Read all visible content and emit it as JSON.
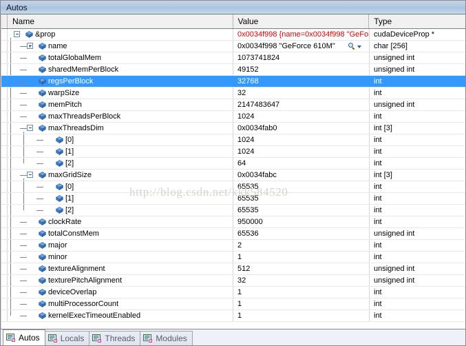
{
  "window": {
    "title": "Autos"
  },
  "columns": {
    "name": "Name",
    "value": "Value",
    "type": "Type"
  },
  "icons": {
    "field": "field-icon",
    "magnifier": "magnifier-visualizer-icon",
    "dropdown": "chevron-down-icon",
    "expand": "plus-expander-icon",
    "collapse": "minus-expander-icon"
  },
  "colors": {
    "selection": "#3399ff",
    "modified_value": "#d90000",
    "title_bar": "#b3c9e3",
    "header": "#f0f0f0",
    "watermark": "#d9d2cd"
  },
  "watermark": "http://blog.csdn.net/kkk584520",
  "rows": [
    {
      "name": "&prop",
      "value": "0x0034f998 {name=0x0034f998 \"GeFor",
      "type": "cudaDeviceProp *",
      "depth": 0,
      "expander": "minus",
      "selected": false,
      "value_color": "red",
      "visualizer": false
    },
    {
      "name": "name",
      "value": "0x0034f998 \"GeForce 610M\"",
      "type": "char [256]",
      "depth": 1,
      "expander": "plus",
      "selected": false,
      "value_color": "black",
      "visualizer": true
    },
    {
      "name": "totalGlobalMem",
      "value": "1073741824",
      "type": "unsigned int",
      "depth": 1,
      "expander": "none",
      "selected": false,
      "value_color": "black",
      "visualizer": false
    },
    {
      "name": "sharedMemPerBlock",
      "value": "49152",
      "type": "unsigned int",
      "depth": 1,
      "expander": "none",
      "selected": false,
      "value_color": "black",
      "visualizer": false
    },
    {
      "name": "regsPerBlock",
      "value": "32768",
      "type": "int",
      "depth": 1,
      "expander": "none",
      "selected": true,
      "value_color": "black",
      "visualizer": false
    },
    {
      "name": "warpSize",
      "value": "32",
      "type": "int",
      "depth": 1,
      "expander": "none",
      "selected": false,
      "value_color": "black",
      "visualizer": false
    },
    {
      "name": "memPitch",
      "value": "2147483647",
      "type": "unsigned int",
      "depth": 1,
      "expander": "none",
      "selected": false,
      "value_color": "black",
      "visualizer": false
    },
    {
      "name": "maxThreadsPerBlock",
      "value": "1024",
      "type": "int",
      "depth": 1,
      "expander": "none",
      "selected": false,
      "value_color": "black",
      "visualizer": false
    },
    {
      "name": "maxThreadsDim",
      "value": "0x0034fab0",
      "type": "int [3]",
      "depth": 1,
      "expander": "minus",
      "selected": false,
      "value_color": "black",
      "visualizer": false
    },
    {
      "name": "[0]",
      "value": "1024",
      "type": "int",
      "depth": 2,
      "expander": "none",
      "selected": false,
      "value_color": "black",
      "visualizer": false
    },
    {
      "name": "[1]",
      "value": "1024",
      "type": "int",
      "depth": 2,
      "expander": "none",
      "selected": false,
      "value_color": "black",
      "visualizer": false
    },
    {
      "name": "[2]",
      "value": "64",
      "type": "int",
      "depth": 2,
      "expander": "none",
      "selected": false,
      "value_color": "black",
      "visualizer": false
    },
    {
      "name": "maxGridSize",
      "value": "0x0034fabc",
      "type": "int [3]",
      "depth": 1,
      "expander": "minus",
      "selected": false,
      "value_color": "black",
      "visualizer": false
    },
    {
      "name": "[0]",
      "value": "65535",
      "type": "int",
      "depth": 2,
      "expander": "none",
      "selected": false,
      "value_color": "black",
      "visualizer": false
    },
    {
      "name": "[1]",
      "value": "65535",
      "type": "int",
      "depth": 2,
      "expander": "none",
      "selected": false,
      "value_color": "black",
      "visualizer": false
    },
    {
      "name": "[2]",
      "value": "65535",
      "type": "int",
      "depth": 2,
      "expander": "none",
      "selected": false,
      "value_color": "black",
      "visualizer": false
    },
    {
      "name": "clockRate",
      "value": "950000",
      "type": "int",
      "depth": 1,
      "expander": "none",
      "selected": false,
      "value_color": "black",
      "visualizer": false
    },
    {
      "name": "totalConstMem",
      "value": "65536",
      "type": "unsigned int",
      "depth": 1,
      "expander": "none",
      "selected": false,
      "value_color": "black",
      "visualizer": false
    },
    {
      "name": "major",
      "value": "2",
      "type": "int",
      "depth": 1,
      "expander": "none",
      "selected": false,
      "value_color": "black",
      "visualizer": false
    },
    {
      "name": "minor",
      "value": "1",
      "type": "int",
      "depth": 1,
      "expander": "none",
      "selected": false,
      "value_color": "black",
      "visualizer": false
    },
    {
      "name": "textureAlignment",
      "value": "512",
      "type": "unsigned int",
      "depth": 1,
      "expander": "none",
      "selected": false,
      "value_color": "black",
      "visualizer": false
    },
    {
      "name": "texturePitchAlignment",
      "value": "32",
      "type": "unsigned int",
      "depth": 1,
      "expander": "none",
      "selected": false,
      "value_color": "black",
      "visualizer": false
    },
    {
      "name": "deviceOverlap",
      "value": "1",
      "type": "int",
      "depth": 1,
      "expander": "none",
      "selected": false,
      "value_color": "black",
      "visualizer": false
    },
    {
      "name": "multiProcessorCount",
      "value": "1",
      "type": "int",
      "depth": 1,
      "expander": "none",
      "selected": false,
      "value_color": "black",
      "visualizer": false
    },
    {
      "name": "kernelExecTimeoutEnabled",
      "value": "1",
      "type": "int",
      "depth": 1,
      "expander": "none",
      "selected": false,
      "value_color": "black",
      "visualizer": false
    }
  ],
  "tabs": [
    {
      "label": "Autos",
      "active": true
    },
    {
      "label": "Locals",
      "active": false
    },
    {
      "label": "Threads",
      "active": false
    },
    {
      "label": "Modules",
      "active": false
    }
  ]
}
